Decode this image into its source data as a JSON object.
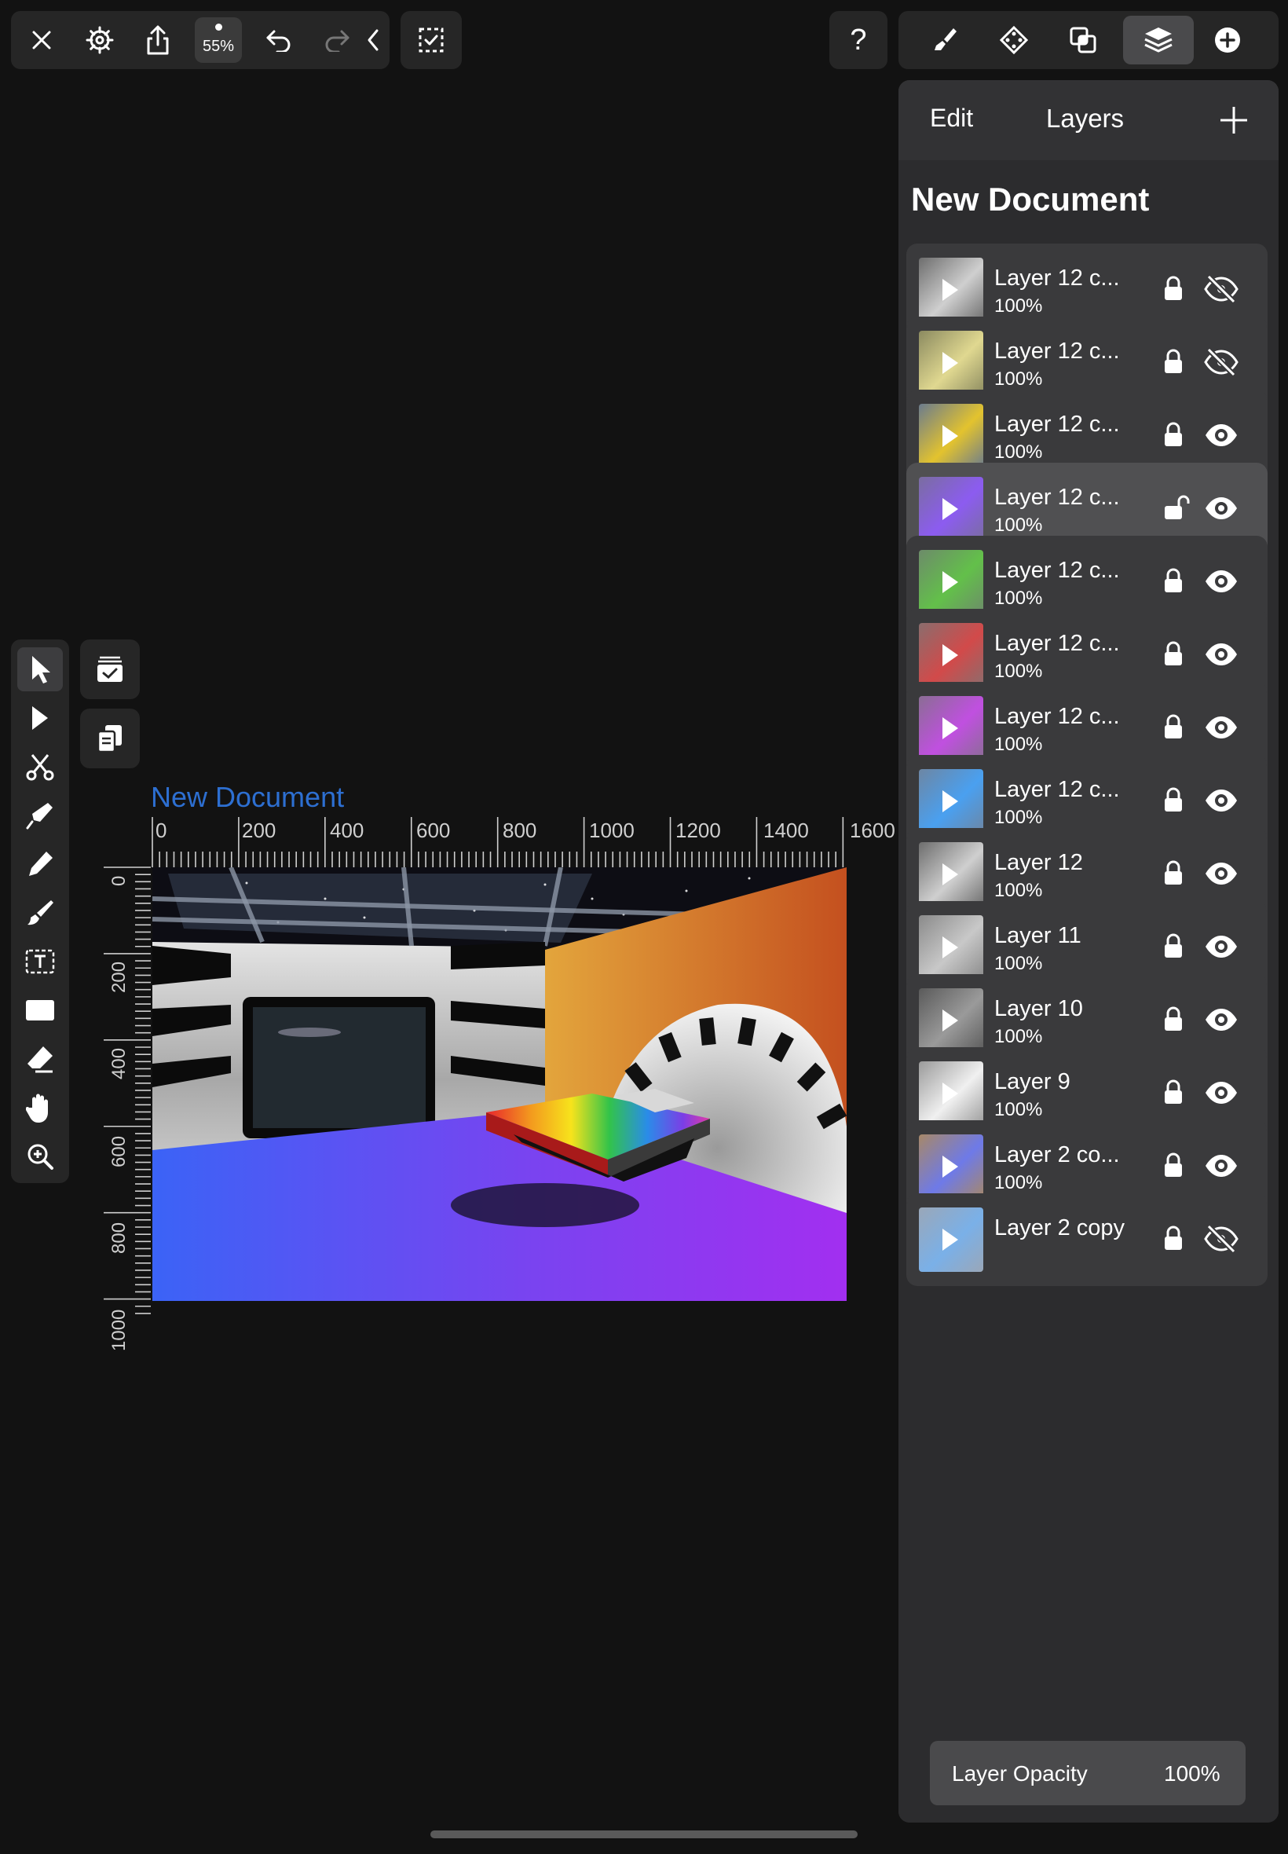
{
  "toolbar": {
    "zoom": "55%",
    "help": "?"
  },
  "panel": {
    "edit_label": "Edit",
    "title": "Layers",
    "document_title": "New Document",
    "layers": [
      {
        "name": "Layer 12 c...",
        "opacity": "100%",
        "locked": true,
        "visible": false,
        "selected": false
      },
      {
        "name": "Layer 12 c...",
        "opacity": "100%",
        "locked": true,
        "visible": false,
        "selected": false
      },
      {
        "name": "Layer 12 c...",
        "opacity": "100%",
        "locked": true,
        "visible": true,
        "selected": false
      },
      {
        "name": "Layer 12 c...",
        "opacity": "100%",
        "locked": false,
        "visible": true,
        "selected": true
      },
      {
        "name": "Layer 12 c...",
        "opacity": "100%",
        "locked": true,
        "visible": true,
        "selected": false
      },
      {
        "name": "Layer 12 c...",
        "opacity": "100%",
        "locked": true,
        "visible": true,
        "selected": false
      },
      {
        "name": "Layer 12 c...",
        "opacity": "100%",
        "locked": true,
        "visible": true,
        "selected": false
      },
      {
        "name": "Layer 12 c...",
        "opacity": "100%",
        "locked": true,
        "visible": true,
        "selected": false
      },
      {
        "name": "Layer 12",
        "opacity": "100%",
        "locked": true,
        "visible": true,
        "selected": false
      },
      {
        "name": "Layer 11",
        "opacity": "100%",
        "locked": true,
        "visible": true,
        "selected": false
      },
      {
        "name": "Layer 10",
        "opacity": "100%",
        "locked": true,
        "visible": true,
        "selected": false
      },
      {
        "name": "Layer 9",
        "opacity": "100%",
        "locked": true,
        "visible": true,
        "selected": false
      },
      {
        "name": "Layer 2 co...",
        "opacity": "100%",
        "locked": true,
        "visible": true,
        "selected": false
      },
      {
        "name": "Layer 2 copy",
        "opacity": "",
        "locked": true,
        "visible": false,
        "selected": false
      }
    ],
    "opacity_label": "Layer Opacity",
    "opacity_value": "100%"
  },
  "canvas": {
    "document_name": "New Document",
    "ruler_x": [
      "0",
      "200",
      "400",
      "600",
      "800",
      "1000",
      "1200",
      "1400",
      "1600"
    ],
    "ruler_y": [
      "0",
      "200",
      "400",
      "600",
      "800",
      "1000"
    ]
  }
}
